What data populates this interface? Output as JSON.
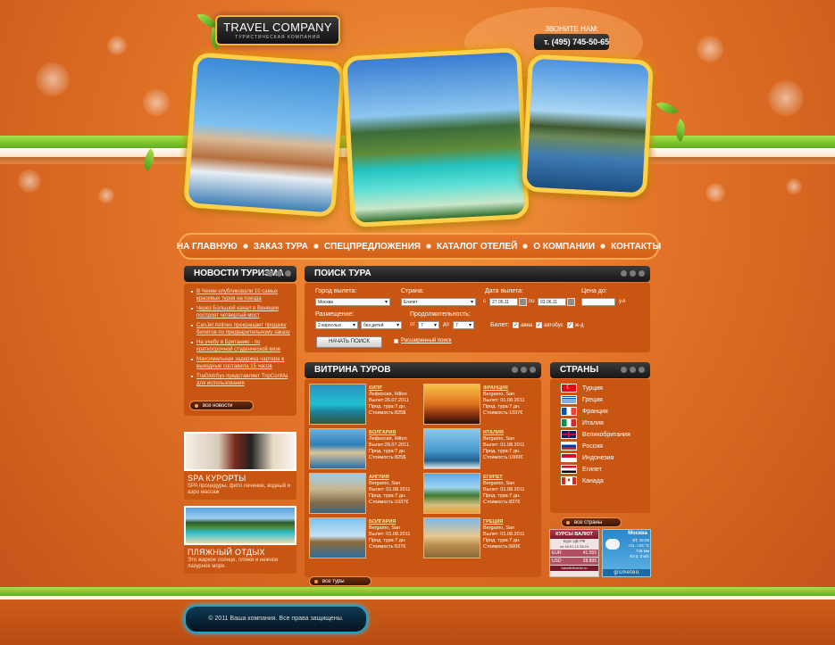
{
  "header": {
    "logo_title": "TRAVEL COMPANY",
    "logo_subtitle": "ТУРИСТИЧЕСКАЯ КОМПАНИЯ",
    "call_label": "ЗВОНИТЕ НАМ:",
    "phone": "т. (495) 745-50-65"
  },
  "nav": {
    "items": [
      "НА ГЛАВНУЮ",
      "ЗАКАЗ ТУРА",
      "СПЕЦПРЕДЛОЖЕНИЯ",
      "КАТАЛОГ ОТЕЛЕЙ",
      "О КОМПАНИИ",
      "КОНТАКТЫ"
    ]
  },
  "news": {
    "title": "НОВОСТИ ТУРИЗМА",
    "items": [
      "В Чехии опубликовали 10 самых красивых туров на поезда",
      "Через Большой канал в Венеции построят четвертый мост",
      "CanJet Airlines прекращает продажу билетов по предварительному заказу",
      "На учебу в Британию - по краткосрочной студенческой визе",
      "Максимальная задержка чартера в выходные составила 15 часов",
      "TraGlobSys представляет TripConMa для использования"
    ],
    "all_label": "все новости"
  },
  "promos": [
    {
      "title": "SPA КУРОРТЫ",
      "desc": "SPA процедуры, фито лечение, водный и аэро массаж"
    },
    {
      "title": "ПЛЯЖНЫЙ ОТДЫХ",
      "desc": "Это жаркое солнце, пляжи и нежное лазурное море."
    }
  ],
  "search": {
    "title": "ПОИСК ТУРА",
    "city_label": "Город вылета:",
    "city_value": "Москва",
    "country_label": "Страна:",
    "country_value": "Египет",
    "date_label": "Дата вылета:",
    "date_from_prefix": "с",
    "date_from": "27.05.11",
    "date_to_prefix": "по",
    "date_to": "03.06.11",
    "price_label": "Цена до:",
    "price_unit": "у.е",
    "placement_label": "Размещение:",
    "adults_value": "2 взрослых",
    "children_value": "без детей",
    "duration_label": "Продолжительность:",
    "dur_from_prefix": "от",
    "dur_from": "7",
    "dur_to_prefix": "до",
    "dur_to": "7",
    "ticket_label": "Билет:",
    "ticket_avia": "авиа",
    "ticket_bus": "автобус",
    "ticket_rail": "ж-д",
    "submit_label": "НАЧАТЬ ПОИСК",
    "advanced_label": "Расширенный поиск"
  },
  "tours": {
    "title": "ВИТРИНА ТУРОВ",
    "items": [
      {
        "name": "КИПР",
        "place": "Лефкосия, Hilton",
        "dep": "Вылет:26.07.2011",
        "dur": "Прод. тура:7 дн.",
        "price": "Стоимость:825$"
      },
      {
        "name": "ФРАНЦИЯ",
        "place": "Bergamo, San",
        "dep": "Вылет: 01.08.2011",
        "dur": "Прод. тура:7 дн.",
        "price": "Стоимость:1037€"
      },
      {
        "name": "БОЛГАРИЯ",
        "place": "Лефкосия, Hilton",
        "dep": "Вылет:26.07.2011",
        "dur": "Прод. тура:7 дн.",
        "price": "Стоимость:825$"
      },
      {
        "name": "ИТАЛИЯ",
        "place": "Bergamo, San",
        "dep": "Вылет: 01.08.2011",
        "dur": "Прод. тура:7 дн.",
        "price": "Стоимость:1000€"
      },
      {
        "name": "АНГЛИЯ",
        "place": "Bergamo, San",
        "dep": "Вылет: 01.08.2011",
        "dur": "Прод. тура:7 дн.",
        "price": "Стоимость:1037€"
      },
      {
        "name": "ЕГИПЕТ",
        "place": "Bergamo, San",
        "dep": "Вылет: 01.08.2011",
        "dur": "Прод. тура:7 дн.",
        "price": "Стоимость:837€"
      },
      {
        "name": "БОЛГАРИЯ",
        "place": "Bergamo, San",
        "dep": "Вылет: 01.08.2011",
        "dur": "Прод. тура:7 дн.",
        "price": "Стоимость:537€"
      },
      {
        "name": "ГРЕЦИЯ",
        "place": "Bergamo, San",
        "dep": "Вылет: 01.08.2011",
        "dur": "Прод. тура:7 дн.",
        "price": "Стоимость:560€"
      }
    ],
    "all_label": "все туры"
  },
  "countries": {
    "title": "СТРАНЫ",
    "items": [
      "Турция",
      "Греция",
      "Франция",
      "Италия",
      "Великобритания",
      "Россия",
      "Индонезия",
      "Египет",
      "Канада"
    ],
    "all_label": "все страны"
  },
  "currency": {
    "title": "КУРСЫ ВАЛЮТ",
    "source": "Курс ЦБ РФ",
    "date": "на 18.01.10 08:24",
    "eur_label": "EUR",
    "eur_value": "41.555",
    "usd_label": "USD",
    "usd_value": "28.895",
    "site": "travelinformer.ru"
  },
  "weather": {
    "city": "Москва",
    "date": "ВТ, 16:06",
    "temp": "+21..+23 °C",
    "pressure": "746 мм",
    "wind": "Ю-З, 3 м/с",
    "brand": "gismeteo"
  },
  "footer": {
    "copyright": "© 2011  Ваша компания. Все права защищены."
  }
}
